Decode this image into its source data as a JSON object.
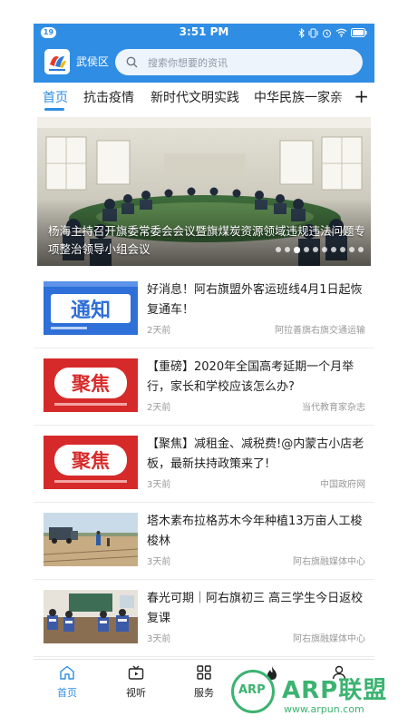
{
  "status_bar": {
    "badge": "19",
    "time": "3:51 PM"
  },
  "header": {
    "region": "武侯区",
    "search_placeholder": "搜索你想要的资讯"
  },
  "tabs": [
    {
      "label": "首页",
      "active": true
    },
    {
      "label": "抗击疫情",
      "active": false
    },
    {
      "label": "新时代文明实践",
      "active": false
    },
    {
      "label": "中华民族一家亲",
      "active": false
    }
  ],
  "tab_add": "+",
  "banner": {
    "caption": "杨海主持召开旗委常委会会议暨旗煤炭资源领域违规违法问题专项整治领导小组会议",
    "dot_count": 10,
    "active_dot": 2
  },
  "news": [
    {
      "title": "好消息！阿右旗盟外客运班线4月1日起恢复通车！",
      "time": "2天前",
      "source": "阿拉善旗右旗交通运输",
      "thumb": "notice"
    },
    {
      "title": "【重磅】2020年全国高考延期一个月举行，家长和学校应该怎么办?",
      "time": "2天前",
      "source": "当代教育家杂志",
      "thumb": "focus"
    },
    {
      "title": "【聚焦】减租金、减税费!@内蒙古小店老板，最新扶持政策来了!",
      "time": "3天前",
      "source": "中国政府网",
      "thumb": "focus"
    },
    {
      "title": "塔木素布拉格苏木今年种植13万亩人工梭梭林",
      "time": "3天前",
      "source": "阿右旗融媒体中心",
      "thumb": "desert"
    },
    {
      "title": "春光可期｜阿右旗初三 高三学生今日返校复课",
      "time": "3天前",
      "source": "阿右旗融媒体中心",
      "thumb": "classroom"
    }
  ],
  "thumb_text": {
    "notice": "通知",
    "focus": "聚焦"
  },
  "tabbar": [
    {
      "label": "首页",
      "icon": "home-icon",
      "active": true
    },
    {
      "label": "视听",
      "icon": "tv-icon",
      "active": false
    },
    {
      "label": "服务",
      "icon": "grid-icon",
      "active": false
    },
    {
      "label": "",
      "icon": "fire-icon",
      "active": false
    },
    {
      "label": "",
      "icon": "user-icon",
      "active": false
    }
  ],
  "watermark": {
    "mark": "ARP",
    "name": "ARP联盟",
    "url": "www.arpun.com"
  },
  "colors": {
    "primary": "#2f8de4",
    "focus_red": "#d62a2a",
    "watermark_green": "#3cb371"
  }
}
